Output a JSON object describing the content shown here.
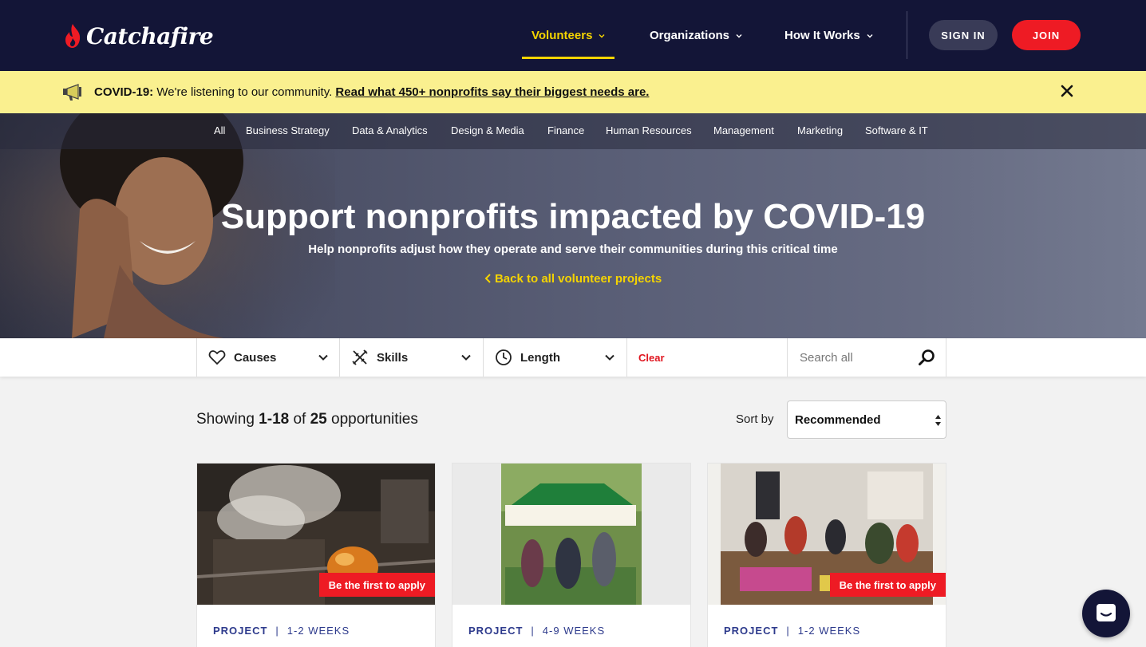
{
  "brand": {
    "name": "Catchafire"
  },
  "nav": {
    "items": [
      {
        "label": "Volunteers",
        "active": true
      },
      {
        "label": "Organizations",
        "active": false
      },
      {
        "label": "How It Works",
        "active": false
      }
    ],
    "signin_label": "SIGN IN",
    "join_label": "JOIN"
  },
  "banner": {
    "prefix": "COVID-19:",
    "text": " We're listening to our community. ",
    "link": "Read what 450+ nonprofits say their biggest needs are."
  },
  "categories": [
    "All",
    "Business Strategy",
    "Data & Analytics",
    "Design & Media",
    "Finance",
    "Human Resources",
    "Management",
    "Marketing",
    "Software & IT"
  ],
  "hero": {
    "title": "Support nonprofits impacted by COVID-19",
    "subtitle": "Help nonprofits adjust how they operate and serve their communities during this critical time",
    "back_link": "Back to all volunteer projects"
  },
  "filters": {
    "causes_label": "Causes",
    "skills_label": "Skills",
    "length_label": "Length",
    "clear_label": "Clear",
    "search_placeholder": "Search all"
  },
  "results": {
    "showing_prefix": "Showing ",
    "range": "1-18",
    "of": " of ",
    "total": "25",
    "suffix": " opportunities",
    "sort_label": "Sort by",
    "sort_value": "Recommended"
  },
  "cards": [
    {
      "type": "PROJECT",
      "length": "1-2 WEEKS",
      "badge": "Be the first to apply"
    },
    {
      "type": "PROJECT",
      "length": "4-9 WEEKS",
      "badge": ""
    },
    {
      "type": "PROJECT",
      "length": "1-2 WEEKS",
      "badge": "Be the first to apply"
    }
  ],
  "colors": {
    "navy": "#131537",
    "accent_yellow": "#f5d400",
    "red": "#ee1b24",
    "banner": "#faf08f"
  }
}
